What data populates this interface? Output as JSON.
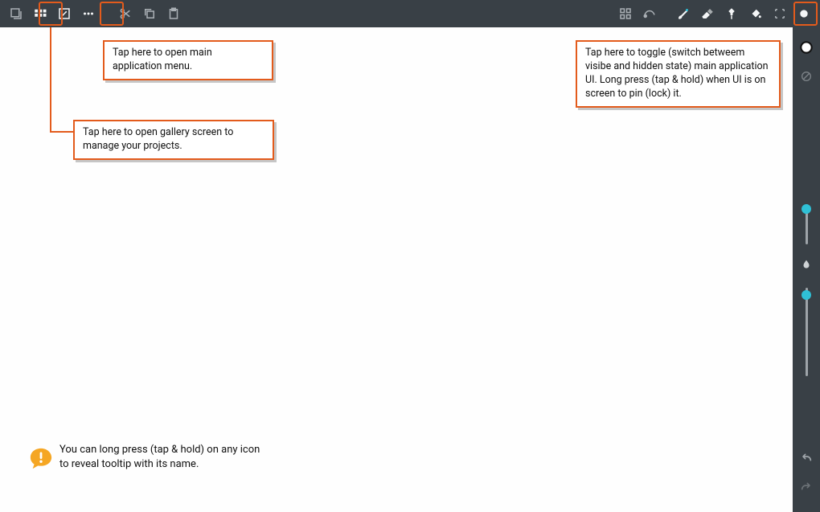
{
  "callouts": {
    "menu": "Tap here to open main application menu.",
    "gallery": "Tap here to open gallery screen to manage your projects.",
    "toggle": "Tap here to toggle (switch betweem visibe and hidden state) main application UI. Long press (tap & hold) when UI is on screen to pin (lock) it."
  },
  "tip": "You can long press (tap & hold) on any icon to reveal tooltip with its name.",
  "toolbar": {
    "left": [
      "gallery",
      "grid",
      "resize",
      "menu",
      "cut",
      "copy",
      "paste"
    ],
    "right": [
      "snap",
      "curve",
      "brush",
      "eraser",
      "smudge",
      "fill",
      "select",
      "toggle-ui"
    ]
  },
  "sidebar": {
    "top_icons": [
      "color-ring",
      "disabled"
    ],
    "sliders": {
      "top_pos": 0.12,
      "bottom_pos": 0.08
    },
    "bottom_icons": [
      "undo",
      "redo"
    ]
  },
  "colors": {
    "accent": "#e35b1c",
    "bar": "#394046",
    "slider": "#2fc0d6",
    "tip_bubble": "#f5a623"
  }
}
